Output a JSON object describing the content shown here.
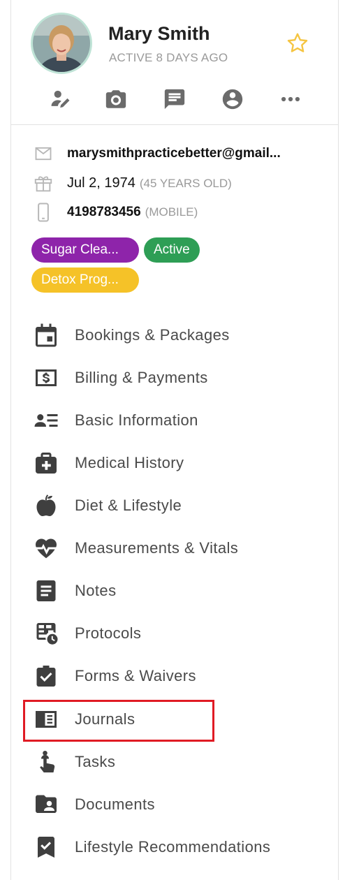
{
  "profile": {
    "name": "Mary Smith",
    "status": "ACTIVE 8 DAYS AGO",
    "favorite_icon": "star-outline-icon",
    "star_color": "#f5c542"
  },
  "actions": [
    {
      "icon": "edit-person-icon"
    },
    {
      "icon": "camera-icon"
    },
    {
      "icon": "chat-icon"
    },
    {
      "icon": "account-circle-icon"
    },
    {
      "icon": "more-icon"
    }
  ],
  "contact": {
    "email": "marysmithpracticebetter@gmail...",
    "birthday": "Jul 2, 1974",
    "age": "(45 YEARS OLD)",
    "phone": "4198783456",
    "phone_type": "(MOBILE)"
  },
  "tags": [
    {
      "label": "Sugar Clea...",
      "color": "#8e24aa"
    },
    {
      "label": "Active",
      "color": "#2e9e55"
    },
    {
      "label": "Detox Prog...",
      "color": "#f5c228"
    }
  ],
  "menu": [
    {
      "label": "Bookings & Packages",
      "icon": "calendar-icon"
    },
    {
      "label": "Billing & Payments",
      "icon": "dollar-bill-icon"
    },
    {
      "label": "Basic Information",
      "icon": "contact-list-icon"
    },
    {
      "label": "Medical History",
      "icon": "medical-bag-icon"
    },
    {
      "label": "Diet & Lifestyle",
      "icon": "apple-icon"
    },
    {
      "label": "Measurements & Vitals",
      "icon": "heart-pulse-icon"
    },
    {
      "label": "Notes",
      "icon": "note-icon"
    },
    {
      "label": "Protocols",
      "icon": "table-clock-icon"
    },
    {
      "label": "Forms & Waivers",
      "icon": "clipboard-check-icon"
    },
    {
      "label": "Journals",
      "icon": "journal-icon"
    },
    {
      "label": "Tasks",
      "icon": "finger-ribbon-icon"
    },
    {
      "label": "Documents",
      "icon": "folder-account-icon"
    },
    {
      "label": "Lifestyle Recommendations",
      "icon": "bookmark-check-icon"
    }
  ],
  "highlight_color": "#e01b24"
}
